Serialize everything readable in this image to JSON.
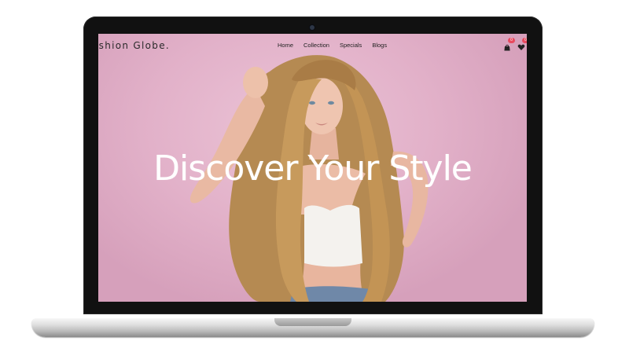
{
  "site": {
    "brand": "ashion Globe."
  },
  "nav": {
    "items": [
      {
        "label": "Home"
      },
      {
        "label": "Collection"
      },
      {
        "label": "Specials"
      },
      {
        "label": "Blogs"
      }
    ]
  },
  "icons": {
    "cart": {
      "name": "shopping-bag-icon",
      "badge": "0"
    },
    "wishlist": {
      "name": "heart-icon",
      "badge": "0"
    }
  },
  "hero": {
    "title": "Discover Your Style",
    "image_subject": "woman-with-long-wavy-blonde-hair-pink-background"
  },
  "colors": {
    "background_pink": "#e3b2cb",
    "hero_text": "#ffffff",
    "nav_text": "#222222",
    "badge": "#e84a5f",
    "laptop_bezel": "#111111"
  }
}
